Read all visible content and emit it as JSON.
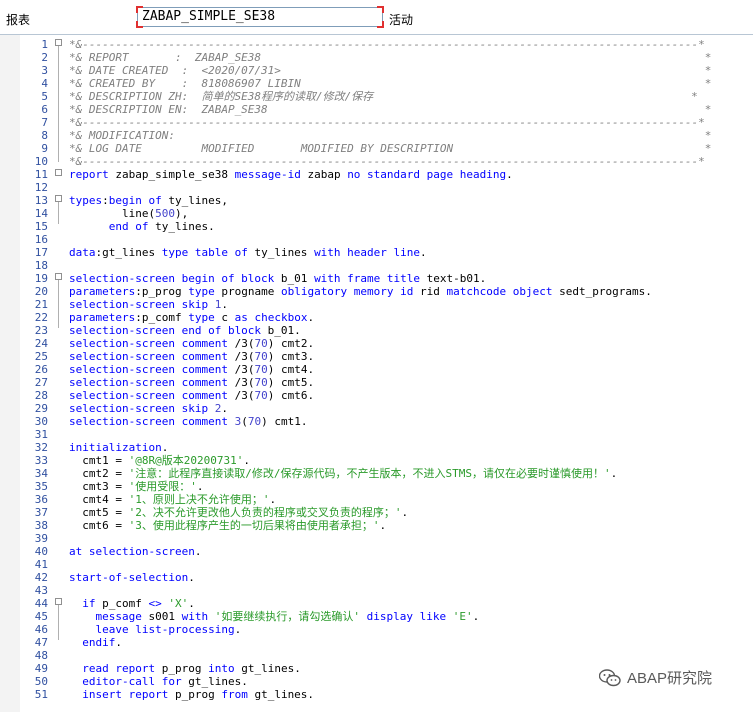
{
  "toolbar": {
    "program_label": "报表",
    "program_value": "ZABAP_SIMPLE_SE38",
    "status": "活动"
  },
  "watermark": "ABAP研究院",
  "code_lines": [
    {
      "n": "1",
      "segs": [
        {
          "c": "cmt",
          "t": "*&---------------------------------------------------------------------------------------------*"
        }
      ]
    },
    {
      "n": "2",
      "segs": [
        {
          "c": "cmt",
          "t": "*& REPORT       :  ZABAP_SE38                                                                   *"
        }
      ]
    },
    {
      "n": "3",
      "segs": [
        {
          "c": "cmt",
          "t": "*& DATE CREATED  :  <2020/07/31>                                                                *"
        }
      ]
    },
    {
      "n": "4",
      "segs": [
        {
          "c": "cmt",
          "t": "*& CREATED BY    :  818086907 LIBIN                                                             *"
        }
      ]
    },
    {
      "n": "5",
      "segs": [
        {
          "c": "cmt",
          "t": "*& DESCRIPTION ZH:  简单的SE38程序的读取/修改/保存                                                *"
        }
      ]
    },
    {
      "n": "6",
      "segs": [
        {
          "c": "cmt",
          "t": "*& DESCRIPTION EN:  ZABAP_SE38                                                                  *"
        }
      ]
    },
    {
      "n": "7",
      "segs": [
        {
          "c": "cmt",
          "t": "*&---------------------------------------------------------------------------------------------*"
        }
      ]
    },
    {
      "n": "8",
      "segs": [
        {
          "c": "cmt",
          "t": "*& MODIFICATION:                                                                                *"
        }
      ]
    },
    {
      "n": "9",
      "segs": [
        {
          "c": "cmt",
          "t": "*& LOG DATE         MODIFIED       MODIFIED BY DESCRIPTION                                      *"
        }
      ]
    },
    {
      "n": "10",
      "segs": [
        {
          "c": "cmt",
          "t": "*&---------------------------------------------------------------------------------------------*"
        }
      ]
    },
    {
      "n": "11",
      "segs": [
        {
          "c": "kw",
          "t": "report"
        },
        {
          "c": "id",
          "t": " zabap_simple_se38 "
        },
        {
          "c": "kw",
          "t": "message-id"
        },
        {
          "c": "id",
          "t": " zabap "
        },
        {
          "c": "kw",
          "t": "no standard page heading"
        },
        {
          "c": "id",
          "t": "."
        }
      ]
    },
    {
      "n": "12",
      "segs": []
    },
    {
      "n": "13",
      "segs": [
        {
          "c": "kw",
          "t": "types"
        },
        {
          "c": "id",
          "t": ":"
        },
        {
          "c": "kw",
          "t": "begin of"
        },
        {
          "c": "id",
          "t": " ty_lines,"
        }
      ]
    },
    {
      "n": "14",
      "segs": [
        {
          "c": "id",
          "t": "        line"
        },
        {
          "c": "id",
          "t": "("
        },
        {
          "c": "nm",
          "t": "500"
        },
        {
          "c": "id",
          "t": "),"
        }
      ]
    },
    {
      "n": "15",
      "segs": [
        {
          "c": "id",
          "t": "      "
        },
        {
          "c": "kw",
          "t": "end of"
        },
        {
          "c": "id",
          "t": " ty_lines."
        }
      ]
    },
    {
      "n": "16",
      "segs": []
    },
    {
      "n": "17",
      "segs": [
        {
          "c": "kw",
          "t": "data"
        },
        {
          "c": "id",
          "t": ":gt_lines "
        },
        {
          "c": "kw",
          "t": "type table of"
        },
        {
          "c": "id",
          "t": " ty_lines "
        },
        {
          "c": "kw",
          "t": "with header line"
        },
        {
          "c": "id",
          "t": "."
        }
      ]
    },
    {
      "n": "18",
      "segs": []
    },
    {
      "n": "19",
      "segs": [
        {
          "c": "kw",
          "t": "selection-screen begin of block"
        },
        {
          "c": "id",
          "t": " b_01 "
        },
        {
          "c": "kw",
          "t": "with frame title"
        },
        {
          "c": "id",
          "t": " text-b01."
        }
      ]
    },
    {
      "n": "20",
      "segs": [
        {
          "c": "kw",
          "t": "parameters"
        },
        {
          "c": "id",
          "t": ":p_prog "
        },
        {
          "c": "kw",
          "t": "type"
        },
        {
          "c": "id",
          "t": " progname "
        },
        {
          "c": "kw",
          "t": "obligatory memory id"
        },
        {
          "c": "id",
          "t": " rid "
        },
        {
          "c": "kw",
          "t": "matchcode object"
        },
        {
          "c": "id",
          "t": " sedt_programs."
        }
      ]
    },
    {
      "n": "21",
      "segs": [
        {
          "c": "kw",
          "t": "selection-screen skip"
        },
        {
          "c": "id",
          "t": " "
        },
        {
          "c": "nm",
          "t": "1"
        },
        {
          "c": "id",
          "t": "."
        }
      ]
    },
    {
      "n": "22",
      "segs": [
        {
          "c": "kw",
          "t": "parameters"
        },
        {
          "c": "id",
          "t": ":p_comf "
        },
        {
          "c": "kw",
          "t": "type"
        },
        {
          "c": "id",
          "t": " c "
        },
        {
          "c": "kw",
          "t": "as checkbox"
        },
        {
          "c": "id",
          "t": "."
        }
      ]
    },
    {
      "n": "23",
      "segs": [
        {
          "c": "kw",
          "t": "selection-screen end of block"
        },
        {
          "c": "id",
          "t": " b_01."
        }
      ]
    },
    {
      "n": "24",
      "segs": [
        {
          "c": "kw",
          "t": "selection-screen comment"
        },
        {
          "c": "id",
          "t": " /3("
        },
        {
          "c": "nm",
          "t": "70"
        },
        {
          "c": "id",
          "t": ") cmt2."
        }
      ]
    },
    {
      "n": "25",
      "segs": [
        {
          "c": "kw",
          "t": "selection-screen comment"
        },
        {
          "c": "id",
          "t": " /3("
        },
        {
          "c": "nm",
          "t": "70"
        },
        {
          "c": "id",
          "t": ") cmt3."
        }
      ]
    },
    {
      "n": "26",
      "segs": [
        {
          "c": "kw",
          "t": "selection-screen comment"
        },
        {
          "c": "id",
          "t": " /3("
        },
        {
          "c": "nm",
          "t": "70"
        },
        {
          "c": "id",
          "t": ") cmt4."
        }
      ]
    },
    {
      "n": "27",
      "segs": [
        {
          "c": "kw",
          "t": "selection-screen comment"
        },
        {
          "c": "id",
          "t": " /3("
        },
        {
          "c": "nm",
          "t": "70"
        },
        {
          "c": "id",
          "t": ") cmt5."
        }
      ]
    },
    {
      "n": "28",
      "segs": [
        {
          "c": "kw",
          "t": "selection-screen comment"
        },
        {
          "c": "id",
          "t": " /3("
        },
        {
          "c": "nm",
          "t": "70"
        },
        {
          "c": "id",
          "t": ") cmt6."
        }
      ]
    },
    {
      "n": "29",
      "segs": [
        {
          "c": "kw",
          "t": "selection-screen skip"
        },
        {
          "c": "id",
          "t": " "
        },
        {
          "c": "nm",
          "t": "2"
        },
        {
          "c": "id",
          "t": "."
        }
      ]
    },
    {
      "n": "30",
      "segs": [
        {
          "c": "kw",
          "t": "selection-screen comment"
        },
        {
          "c": "id",
          "t": " "
        },
        {
          "c": "nm",
          "t": "3"
        },
        {
          "c": "id",
          "t": "("
        },
        {
          "c": "nm",
          "t": "70"
        },
        {
          "c": "id",
          "t": ") cmt1."
        }
      ]
    },
    {
      "n": "31",
      "segs": []
    },
    {
      "n": "32",
      "segs": [
        {
          "c": "kw",
          "t": "initialization"
        },
        {
          "c": "id",
          "t": "."
        }
      ]
    },
    {
      "n": "33",
      "segs": [
        {
          "c": "id",
          "t": "  cmt1 = "
        },
        {
          "c": "st",
          "t": "'@8R@版本20200731'"
        },
        {
          "c": "id",
          "t": "."
        }
      ]
    },
    {
      "n": "34",
      "segs": [
        {
          "c": "id",
          "t": "  cmt2 = "
        },
        {
          "c": "st",
          "t": "'注意：此程序直接读取/修改/保存源代码，不产生版本，不进入STMS，请仅在必要时谨慎使用！'"
        },
        {
          "c": "id",
          "t": "."
        }
      ]
    },
    {
      "n": "35",
      "segs": [
        {
          "c": "id",
          "t": "  cmt3 = "
        },
        {
          "c": "st",
          "t": "'使用受限：'"
        },
        {
          "c": "id",
          "t": "."
        }
      ]
    },
    {
      "n": "36",
      "segs": [
        {
          "c": "id",
          "t": "  cmt4 = "
        },
        {
          "c": "st",
          "t": "'1、原则上决不允许使用；'"
        },
        {
          "c": "id",
          "t": "."
        }
      ]
    },
    {
      "n": "37",
      "segs": [
        {
          "c": "id",
          "t": "  cmt5 = "
        },
        {
          "c": "st",
          "t": "'2、决不允许更改他人负责的程序或交叉负责的程序；'"
        },
        {
          "c": "id",
          "t": "."
        }
      ]
    },
    {
      "n": "38",
      "segs": [
        {
          "c": "id",
          "t": "  cmt6 = "
        },
        {
          "c": "st",
          "t": "'3、使用此程序产生的一切后果将由使用者承担；'"
        },
        {
          "c": "id",
          "t": "."
        }
      ]
    },
    {
      "n": "39",
      "segs": []
    },
    {
      "n": "40",
      "segs": [
        {
          "c": "kw",
          "t": "at selection-screen"
        },
        {
          "c": "id",
          "t": "."
        }
      ]
    },
    {
      "n": "41",
      "segs": []
    },
    {
      "n": "42",
      "segs": [
        {
          "c": "kw",
          "t": "start-of-selection"
        },
        {
          "c": "id",
          "t": "."
        }
      ]
    },
    {
      "n": "43",
      "segs": []
    },
    {
      "n": "44",
      "segs": [
        {
          "c": "id",
          "t": "  "
        },
        {
          "c": "kw",
          "t": "if"
        },
        {
          "c": "id",
          "t": " p_comf "
        },
        {
          "c": "kw",
          "t": "<>"
        },
        {
          "c": "id",
          "t": " "
        },
        {
          "c": "st",
          "t": "'X'"
        },
        {
          "c": "id",
          "t": "."
        }
      ]
    },
    {
      "n": "45",
      "segs": [
        {
          "c": "id",
          "t": "    "
        },
        {
          "c": "kw",
          "t": "message"
        },
        {
          "c": "id",
          "t": " s001 "
        },
        {
          "c": "kw",
          "t": "with"
        },
        {
          "c": "id",
          "t": " "
        },
        {
          "c": "st",
          "t": "'如要继续执行，请勾选确认'"
        },
        {
          "c": "id",
          "t": " "
        },
        {
          "c": "kw",
          "t": "display like"
        },
        {
          "c": "id",
          "t": " "
        },
        {
          "c": "st",
          "t": "'E'"
        },
        {
          "c": "id",
          "t": "."
        }
      ]
    },
    {
      "n": "46",
      "segs": [
        {
          "c": "id",
          "t": "    "
        },
        {
          "c": "kw",
          "t": "leave list-processing"
        },
        {
          "c": "id",
          "t": "."
        }
      ]
    },
    {
      "n": "47",
      "segs": [
        {
          "c": "id",
          "t": "  "
        },
        {
          "c": "kw",
          "t": "endif"
        },
        {
          "c": "id",
          "t": "."
        }
      ]
    },
    {
      "n": "48",
      "segs": []
    },
    {
      "n": "49",
      "segs": [
        {
          "c": "id",
          "t": "  "
        },
        {
          "c": "kw",
          "t": "read report"
        },
        {
          "c": "id",
          "t": " p_prog "
        },
        {
          "c": "kw",
          "t": "into"
        },
        {
          "c": "id",
          "t": " gt_lines."
        }
      ]
    },
    {
      "n": "50",
      "segs": [
        {
          "c": "id",
          "t": "  "
        },
        {
          "c": "kw",
          "t": "editor-call for"
        },
        {
          "c": "id",
          "t": " gt_lines."
        }
      ]
    },
    {
      "n": "51",
      "segs": [
        {
          "c": "id",
          "t": "  "
        },
        {
          "c": "kw",
          "t": "insert report"
        },
        {
          "c": "id",
          "t": " p_prog "
        },
        {
          "c": "kw",
          "t": "from"
        },
        {
          "c": "id",
          "t": " gt_lines."
        }
      ]
    }
  ]
}
